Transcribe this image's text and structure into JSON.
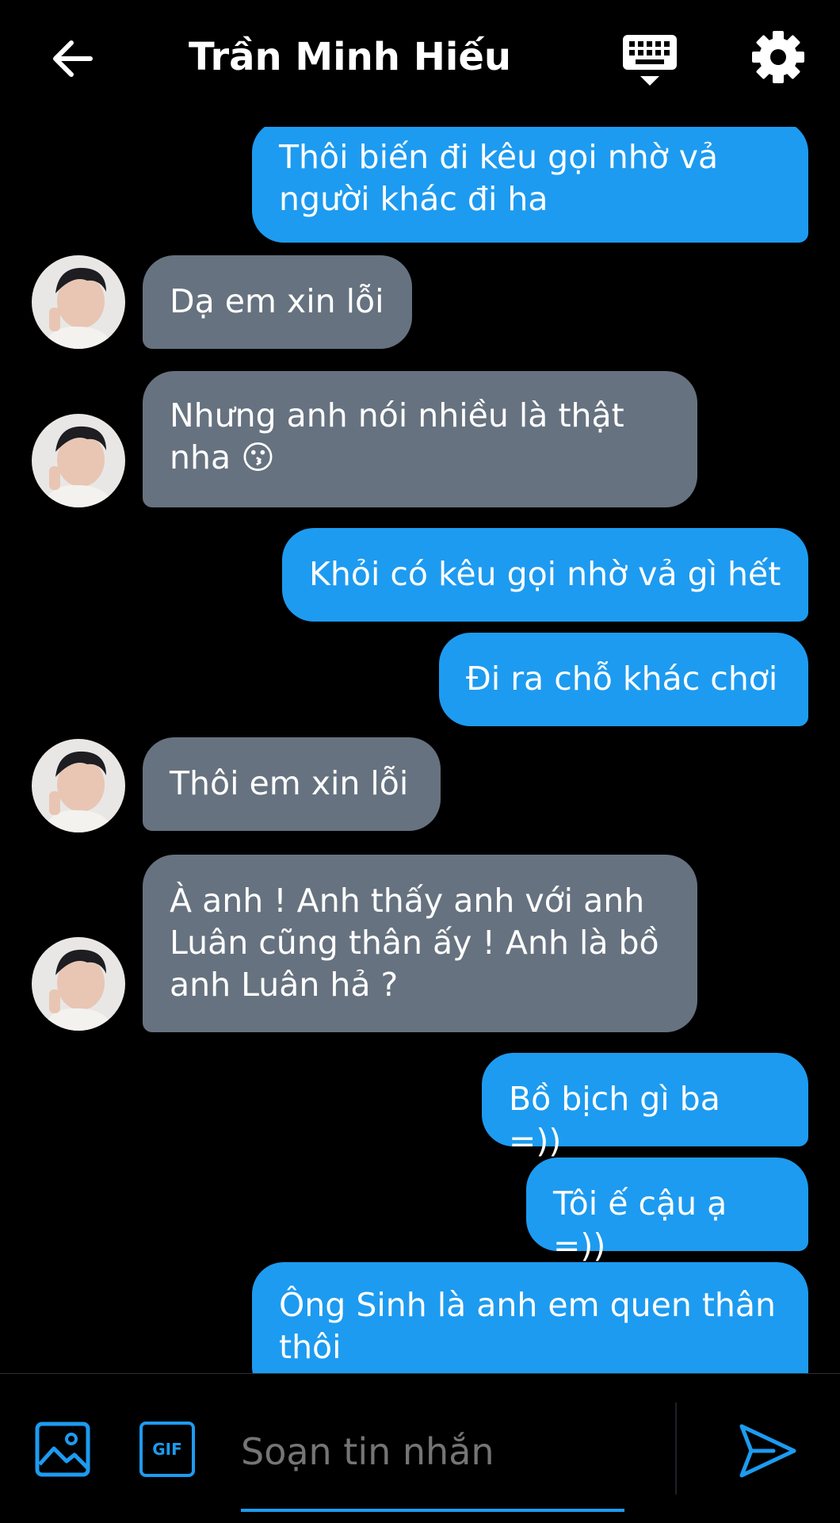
{
  "header": {
    "title": "Trần Minh Hiếu",
    "back_icon": "arrow-left-icon",
    "keyboard_icon": "keyboard-icon",
    "settings_icon": "gear-icon"
  },
  "messages": [
    {
      "dir": "out",
      "text": "Thôi biến đi kêu gọi nhờ vả\nngười khác đi ha"
    },
    {
      "dir": "in",
      "text": "Dạ em xin lỗi"
    },
    {
      "dir": "in",
      "text": "Nhưng anh nói nhiều là thật\nnha 😗"
    },
    {
      "dir": "out",
      "text": "Khỏi có kêu gọi nhờ vả gì hết"
    },
    {
      "dir": "out",
      "text": "Đi ra chỗ khác chơi"
    },
    {
      "dir": "in",
      "text": "Thôi em xin lỗi"
    },
    {
      "dir": "in",
      "text": "À anh ! Anh thấy anh với anh\nLuân cũng thân ấy ! Anh là bồ\nanh Luân hả ?"
    },
    {
      "dir": "out",
      "text": "Bồ bịch gì ba =))"
    },
    {
      "dir": "out",
      "text": "Tôi ế cậu ạ =))"
    },
    {
      "dir": "out",
      "text": "Ông Sinh là anh em quen thân\nthôi"
    }
  ],
  "composer": {
    "placeholder": "Soạn tin nhắn",
    "gif_label": "GIF",
    "image_icon": "image-icon",
    "send_icon": "send-icon"
  },
  "colors": {
    "accent": "#1d9bf0",
    "incoming_bubble": "#66727f",
    "background": "#000000"
  }
}
